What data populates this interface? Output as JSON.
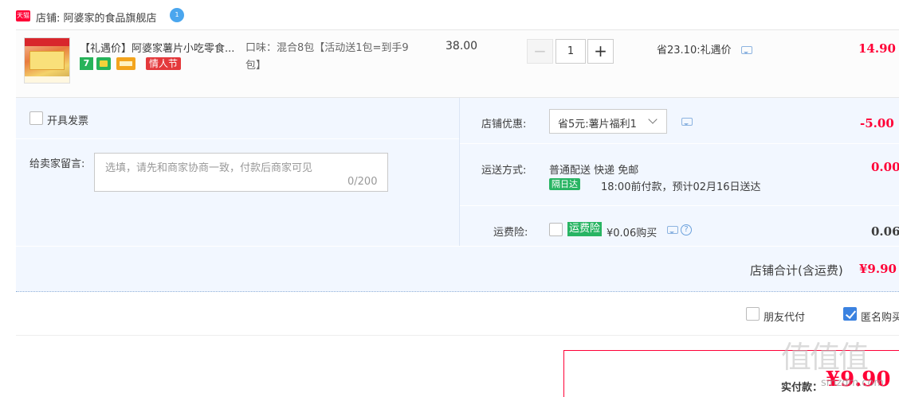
{
  "shop": {
    "badge": "天猫",
    "name": "店铺: 阿婆家的食品旗舰店",
    "chat_badge": "1"
  },
  "item": {
    "title": "【礼遇价】阿婆家薯片小吃零食...",
    "tag_seven": "7",
    "tag_festival": "情人节",
    "sku": "口味：混合8包【活动送1包=到手9包】",
    "unit_price": "38.00",
    "quantity": "1",
    "qty_minus": "−",
    "qty_plus": "+",
    "discount": "省23.10:礼遇价",
    "total": "14.90"
  },
  "options": {
    "invoice_label": "开具发票",
    "memo_label": "给卖家留言:",
    "memo_placeholder": "选填，请先和商家协商一致，付款后商家可见",
    "memo_count": "0/200",
    "shop_discount_label": "店铺优惠:",
    "shop_discount_selected": "省5元:薯片福利1",
    "shop_discount_amount": "-5.00",
    "delivery_label": "运送方式:",
    "delivery_method": "普通配送 快递 免邮",
    "delivery_tag": "隔日达",
    "delivery_estimate": "18:00前付款，预计02月16日送达",
    "delivery_amount": "0.00",
    "insurance_label": "运费险:",
    "insurance_tag": "运费险",
    "insurance_price": "¥0.06购买",
    "insurance_amount": "0.06",
    "help_glyph": "?"
  },
  "summary": {
    "shop_total_label": "店铺合计(含运费)",
    "shop_total_value": "¥9.90",
    "friend_pay_label": "朋友代付",
    "anonymous_label": "匿名购买",
    "pay_label": "实付款：",
    "pay_value": "¥9.90",
    "watermark": "值值值",
    "watermark_site": "smzdm.com"
  },
  "colors": {
    "price_red": "#ff0036",
    "panel_bg": "#f2f7ff",
    "tag_green": "#28b463",
    "checkbox_blue": "#3b82e0"
  }
}
